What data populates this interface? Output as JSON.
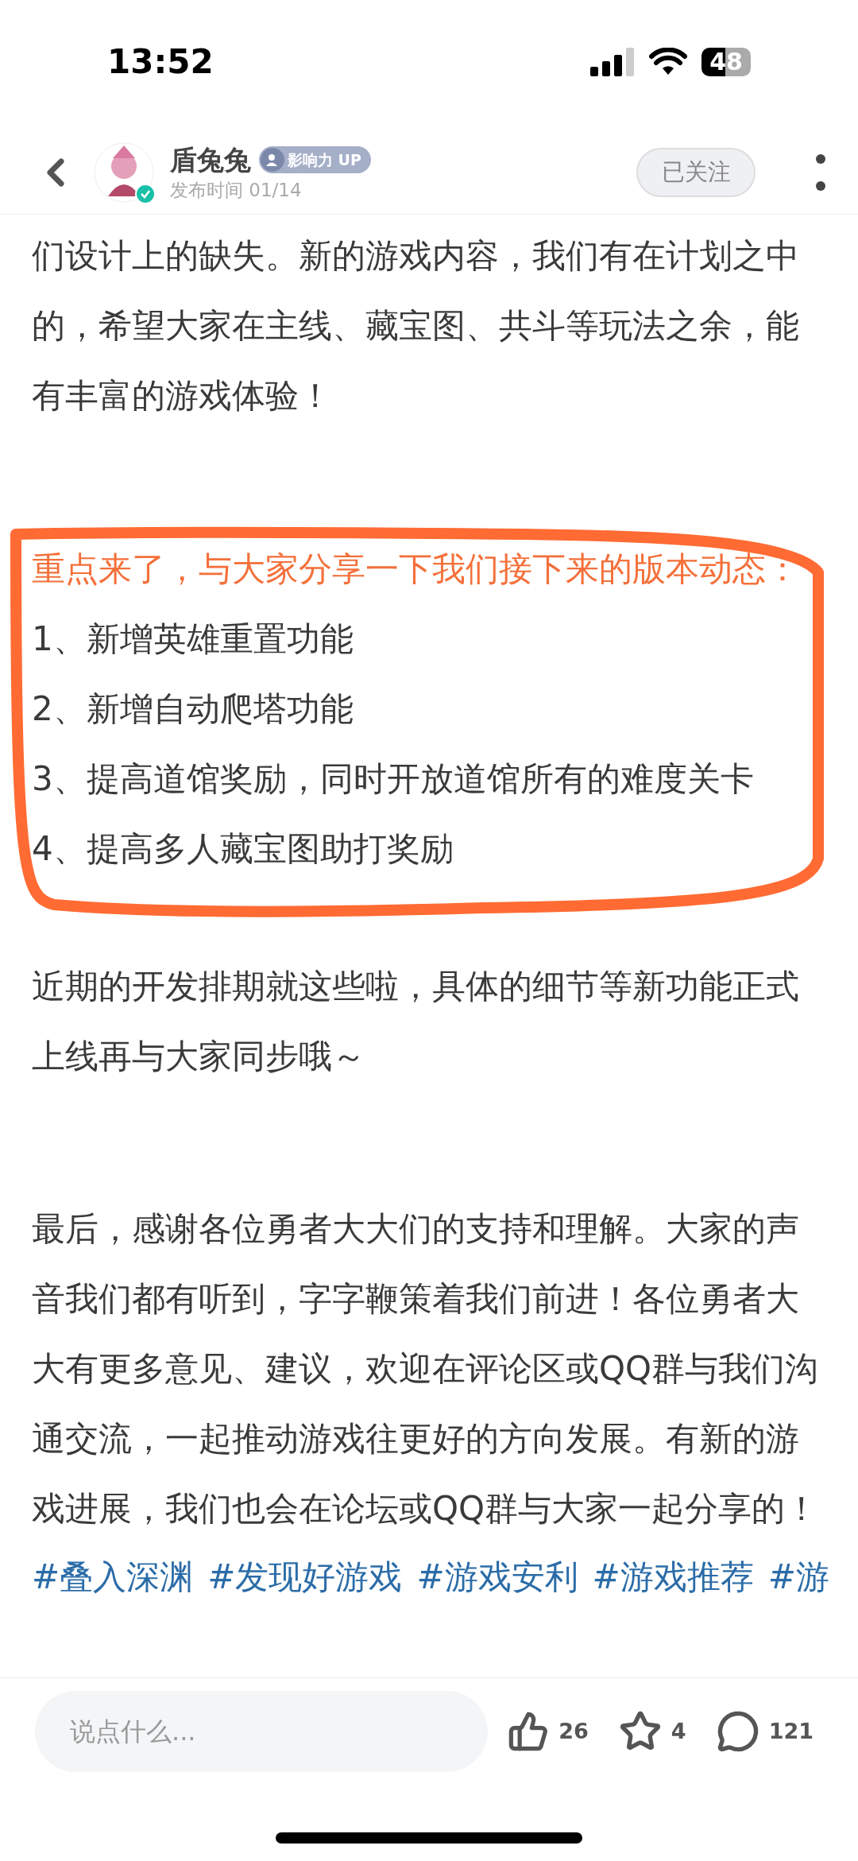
{
  "status_bar": {
    "time": "13:52",
    "battery": "48"
  },
  "header": {
    "author": "盾兔兔",
    "verified": true,
    "badge": "影响力 UP",
    "publish_time": "发布时间 01/14",
    "follow_button": {
      "label": "已关注",
      "following": true
    }
  },
  "article": {
    "intro": "们设计上的缺失。新的游戏内容，我们有在计划之中的，希望大家在主线、藏宝图、共斗等玩法之余，能有丰富的游戏体验！",
    "highlight": {
      "circled": true,
      "lead": "重点来了，与大家分享一下我们接下来的版本动态：",
      "items": [
        "1、新增英雄重置功能",
        "2、新增自动爬塔功能",
        "3、提高道馆奖励，同时开放道馆所有的难度关卡",
        "4、提高多人藏宝图助打奖励"
      ]
    },
    "paragraphs": [
      "近期的开发排期就这些啦，具体的细节等新功能正式上线再与大家同步哦～",
      "最后，感谢各位勇者大大们的支持和理解。大家的声音我们都有听到，字字鞭策着我们前进！各位勇者大大有更多意见、建议，欢迎在评论区或QQ群与我们沟通交流，一起推动游戏往更好的方向发展。有新的游戏进展，我们也会在论坛或QQ群与大家一起分享的！"
    ],
    "hashtags": [
      "#叠入深渊",
      "#发现好游戏",
      "#游戏安利",
      "#游戏推荐",
      "#游"
    ]
  },
  "bottom_bar": {
    "comment_field": {
      "placeholder": "说点什么..."
    },
    "likes": "26",
    "favorites": "4",
    "comments": "121"
  }
}
